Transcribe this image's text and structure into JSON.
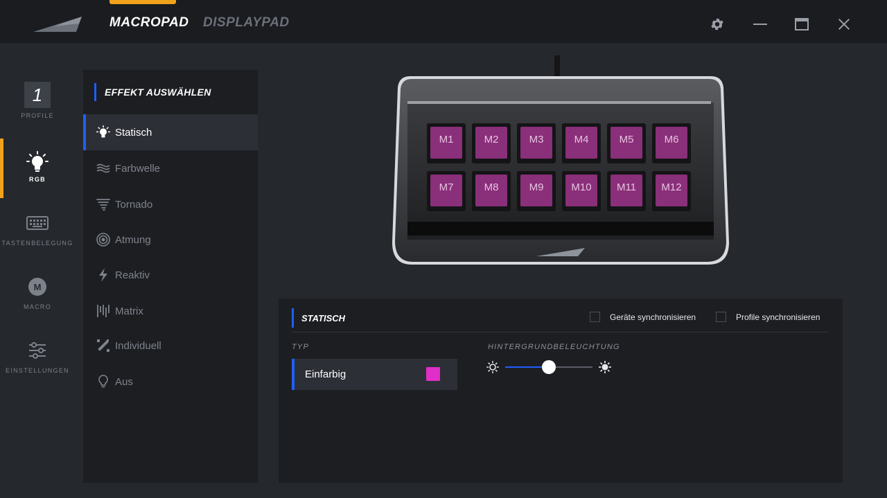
{
  "header": {
    "tabs": [
      {
        "label": "MACROPAD",
        "active": true
      },
      {
        "label": "DISPLAYPAD",
        "active": false
      }
    ],
    "accent_color": "#f0a21c"
  },
  "rail": {
    "profile_number": "1",
    "items": [
      {
        "label": "PROFILE",
        "icon": "profile-number-icon"
      },
      {
        "label": "RGB",
        "icon": "lightbulb-icon",
        "active": true
      },
      {
        "label": "TASTENBELEGUNG",
        "icon": "keyboard-icon"
      },
      {
        "label": "MACRO",
        "icon": "macro-m-icon"
      },
      {
        "label": "EINSTELLUNGEN",
        "icon": "sliders-icon"
      }
    ]
  },
  "effects": {
    "title": "EFFEKT AUSWÄHLEN",
    "items": [
      {
        "label": "Statisch",
        "icon": "lightbulb-icon",
        "active": true
      },
      {
        "label": "Farbwelle",
        "icon": "wave-icon"
      },
      {
        "label": "Tornado",
        "icon": "tornado-icon"
      },
      {
        "label": "Atmung",
        "icon": "breathing-icon"
      },
      {
        "label": "Reaktiv",
        "icon": "lightning-icon"
      },
      {
        "label": "Matrix",
        "icon": "matrix-icon"
      },
      {
        "label": "Individuell",
        "icon": "custom-brush-icon"
      },
      {
        "label": "Aus",
        "icon": "bulb-off-icon"
      }
    ]
  },
  "device": {
    "keys": [
      "M1",
      "M2",
      "M3",
      "M4",
      "M5",
      "M6",
      "M7",
      "M8",
      "M9",
      "M10",
      "M11",
      "M12"
    ],
    "key_color": "#8a2f7a"
  },
  "settings": {
    "title": "STATISCH",
    "sync_devices_label": "Geräte synchronisieren",
    "sync_profiles_label": "Profile synchronisieren",
    "sync_devices_checked": false,
    "sync_profiles_checked": false,
    "typ_label": "TYP",
    "typ_value": "Einfarbig",
    "color": "#e02ec8",
    "backlight_label": "HINTERGRUNDBELEUCHTUNG",
    "backlight_level": 0.5
  }
}
